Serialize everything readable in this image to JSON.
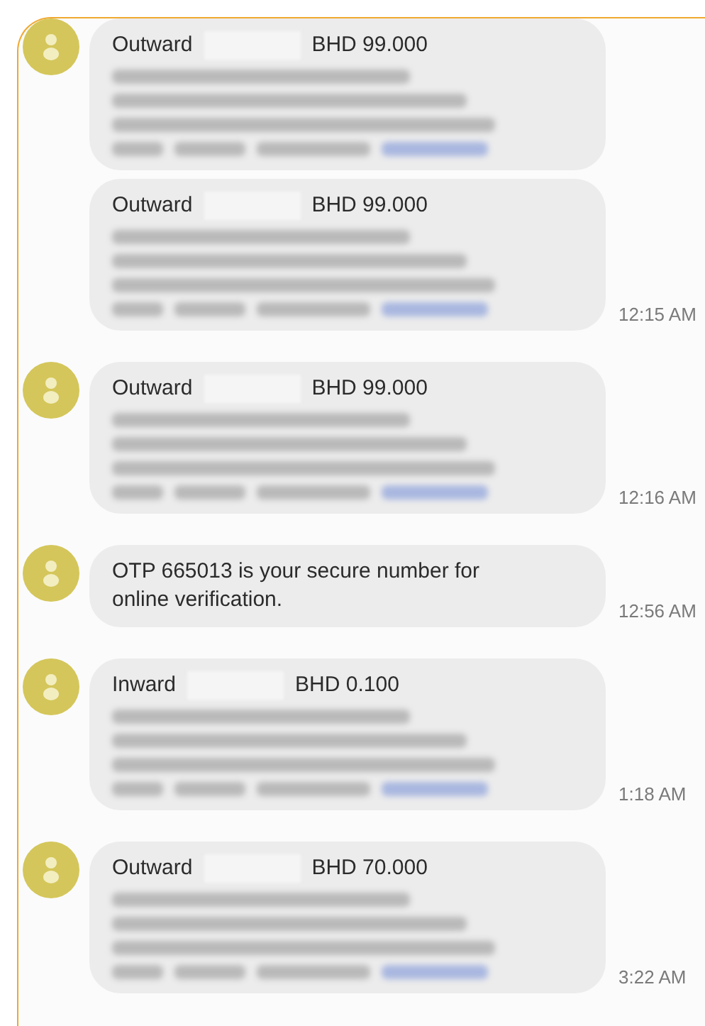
{
  "messages": [
    {
      "bubbles": [
        {
          "kind": "transaction",
          "direction": "Outward",
          "amount": "BHD 99.000"
        },
        {
          "kind": "transaction",
          "direction": "Outward",
          "amount": "BHD 99.000"
        }
      ],
      "time": "12:15 AM"
    },
    {
      "bubbles": [
        {
          "kind": "transaction",
          "direction": "Outward",
          "amount": "BHD 99.000"
        }
      ],
      "time": "12:16 AM"
    },
    {
      "bubbles": [
        {
          "kind": "text",
          "text": "OTP 665013 is your secure number for online verification."
        }
      ],
      "time": "12:56 AM"
    },
    {
      "bubbles": [
        {
          "kind": "transaction",
          "direction": "Inward",
          "amount": "BHD 0.100"
        }
      ],
      "time": "1:18 AM"
    },
    {
      "bubbles": [
        {
          "kind": "transaction",
          "direction": "Outward",
          "amount": "BHD 70.000"
        }
      ],
      "time": "3:22 AM"
    }
  ]
}
